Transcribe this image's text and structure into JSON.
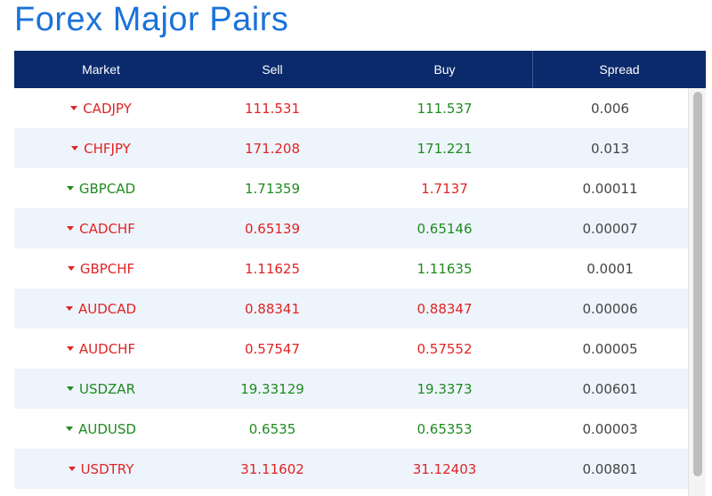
{
  "page": {
    "title": "Forex Major Pairs"
  },
  "table": {
    "headers": {
      "market": "Market",
      "sell": "Sell",
      "buy": "Buy",
      "spread": "Spread"
    },
    "rows": [
      {
        "market": "CADJPY",
        "direction": "down",
        "sell": "111.531",
        "sell_dir": "down",
        "buy": "111.537",
        "buy_dir": "up",
        "spread": "0.006"
      },
      {
        "market": "CHFJPY",
        "direction": "down",
        "sell": "171.208",
        "sell_dir": "down",
        "buy": "171.221",
        "buy_dir": "up",
        "spread": "0.013"
      },
      {
        "market": "GBPCAD",
        "direction": "up",
        "sell": "1.71359",
        "sell_dir": "up",
        "buy": "1.7137",
        "buy_dir": "down",
        "spread": "0.00011"
      },
      {
        "market": "CADCHF",
        "direction": "down",
        "sell": "0.65139",
        "sell_dir": "down",
        "buy": "0.65146",
        "buy_dir": "up",
        "spread": "0.00007"
      },
      {
        "market": "GBPCHF",
        "direction": "down",
        "sell": "1.11625",
        "sell_dir": "down",
        "buy": "1.11635",
        "buy_dir": "up",
        "spread": "0.0001"
      },
      {
        "market": "AUDCAD",
        "direction": "down",
        "sell": "0.88341",
        "sell_dir": "down",
        "buy": "0.88347",
        "buy_dir": "down",
        "spread": "0.00006"
      },
      {
        "market": "AUDCHF",
        "direction": "down",
        "sell": "0.57547",
        "sell_dir": "down",
        "buy": "0.57552",
        "buy_dir": "down",
        "spread": "0.00005"
      },
      {
        "market": "USDZAR",
        "direction": "up",
        "sell": "19.33129",
        "sell_dir": "up",
        "buy": "19.3373",
        "buy_dir": "up",
        "spread": "0.00601"
      },
      {
        "market": "AUDUSD",
        "direction": "up",
        "sell": "0.6535",
        "sell_dir": "up",
        "buy": "0.65353",
        "buy_dir": "up",
        "spread": "0.00003"
      },
      {
        "market": "USDTRY",
        "direction": "down",
        "sell": "31.11602",
        "sell_dir": "down",
        "buy": "31.12403",
        "buy_dir": "down",
        "spread": "0.00801"
      }
    ]
  },
  "icons": {
    "up": "triangle-up-icon",
    "down": "triangle-down-icon"
  },
  "colors": {
    "title": "#1a73d9",
    "header_bg": "#0a2a6b",
    "up": "#1f8a1f",
    "down": "#e02424",
    "row_alt": "#eef4fc"
  }
}
